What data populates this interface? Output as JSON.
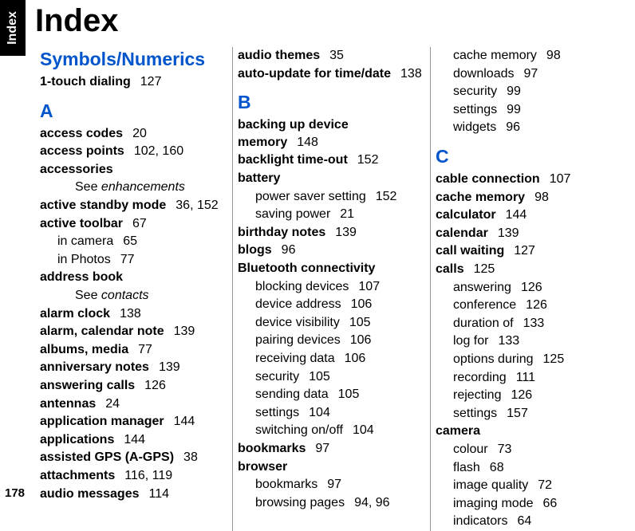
{
  "page": {
    "tab_label": "Index",
    "title": "Index",
    "page_number": "178"
  },
  "col1": {
    "symnum_heading": "Symbols/Numerics",
    "e1_t": "1-touch dialing",
    "e1_p": "127",
    "letter_A": "A",
    "a01_t": "access codes",
    "a01_p": "20",
    "a02_t": "access points",
    "a02_p": "102, 160",
    "a03_t": "accessories",
    "a03_see": "See ",
    "a03_see_target": "enhancements",
    "a04_t": "active standby mode",
    "a04_p": "36, 152",
    "a05_t": "active toolbar",
    "a05_p": "67",
    "a05_s1_t": "in camera",
    "a05_s1_p": "65",
    "a05_s2_t": "in Photos",
    "a05_s2_p": "77",
    "a06_t": "address book",
    "a06_see": "See ",
    "a06_see_target": "contacts",
    "a07_t": "alarm clock",
    "a07_p": "138",
    "a08_t": "alarm, calendar note",
    "a08_p": "139",
    "a09_t": "albums, media",
    "a09_p": "77",
    "a10_t": "anniversary notes",
    "a10_p": "139",
    "a11_t": "answering calls",
    "a11_p": "126",
    "a12_t": "antennas",
    "a12_p": "24",
    "a13_t": "application manager",
    "a13_p": "144",
    "a14_t": "applications",
    "a14_p": "144",
    "a15_t": "assisted GPS (A-GPS)",
    "a15_p": "38",
    "a16_t": "attachments",
    "a16_p": "116, 119",
    "a17_t": "audio messages",
    "a17_p": "114"
  },
  "col2": {
    "top1_t": "audio themes",
    "top1_p": "35",
    "top2_t": "auto-update for time/date",
    "top2_p": "138",
    "letter_B": "B",
    "b01_t": "backing up device memory",
    "b01_p": "148",
    "b02_t": "backlight time-out",
    "b02_p": "152",
    "b03_t": "battery",
    "b03_s1_t": "power saver setting",
    "b03_s1_p": "152",
    "b03_s2_t": "saving power",
    "b03_s2_p": "21",
    "b04_t": "birthday notes",
    "b04_p": "139",
    "b05_t": "blogs",
    "b05_p": "96",
    "b06_t": "Bluetooth connectivity",
    "b06_s1_t": "blocking devices",
    "b06_s1_p": "107",
    "b06_s2_t": "device address",
    "b06_s2_p": "106",
    "b06_s3_t": "device visibility",
    "b06_s3_p": "105",
    "b06_s4_t": "pairing devices",
    "b06_s4_p": "106",
    "b06_s5_t": "receiving data",
    "b06_s5_p": "106",
    "b06_s6_t": "security",
    "b06_s6_p": "105",
    "b06_s7_t": "sending data",
    "b06_s7_p": "105",
    "b06_s8_t": "settings",
    "b06_s8_p": "104",
    "b06_s9_t": "switching on/off",
    "b06_s9_p": "104",
    "b07_t": "bookmarks",
    "b07_p": "97",
    "b08_t": "browser",
    "b08_s1_t": "bookmarks",
    "b08_s1_p": "97",
    "b08_s2_t": "browsing pages",
    "b08_s2_p": "94, 96"
  },
  "col3": {
    "top_s1_t": "cache memory",
    "top_s1_p": "98",
    "top_s2_t": "downloads",
    "top_s2_p": "97",
    "top_s3_t": "security",
    "top_s3_p": "99",
    "top_s4_t": "settings",
    "top_s4_p": "99",
    "top_s5_t": "widgets",
    "top_s5_p": "96",
    "letter_C": "C",
    "c01_t": "cable connection",
    "c01_p": "107",
    "c02_t": "cache memory",
    "c02_p": "98",
    "c03_t": "calculator",
    "c03_p": "144",
    "c04_t": "calendar",
    "c04_p": "139",
    "c05_t": "call waiting",
    "c05_p": "127",
    "c06_t": "calls",
    "c06_p": "125",
    "c06_s1_t": "answering",
    "c06_s1_p": "126",
    "c06_s2_t": "conference",
    "c06_s2_p": "126",
    "c06_s3_t": "duration of",
    "c06_s3_p": "133",
    "c06_s4_t": "log for",
    "c06_s4_p": "133",
    "c06_s5_t": "options during",
    "c06_s5_p": "125",
    "c06_s6_t": "recording",
    "c06_s6_p": "111",
    "c06_s7_t": "rejecting",
    "c06_s7_p": "126",
    "c06_s8_t": "settings",
    "c06_s8_p": "157",
    "c07_t": "camera",
    "c07_s1_t": "colour",
    "c07_s1_p": "73",
    "c07_s2_t": "flash",
    "c07_s2_p": "68",
    "c07_s3_t": "image quality",
    "c07_s3_p": "72",
    "c07_s4_t": "imaging mode",
    "c07_s4_p": "66",
    "c07_s5_t": "indicators",
    "c07_s5_p": "64"
  }
}
